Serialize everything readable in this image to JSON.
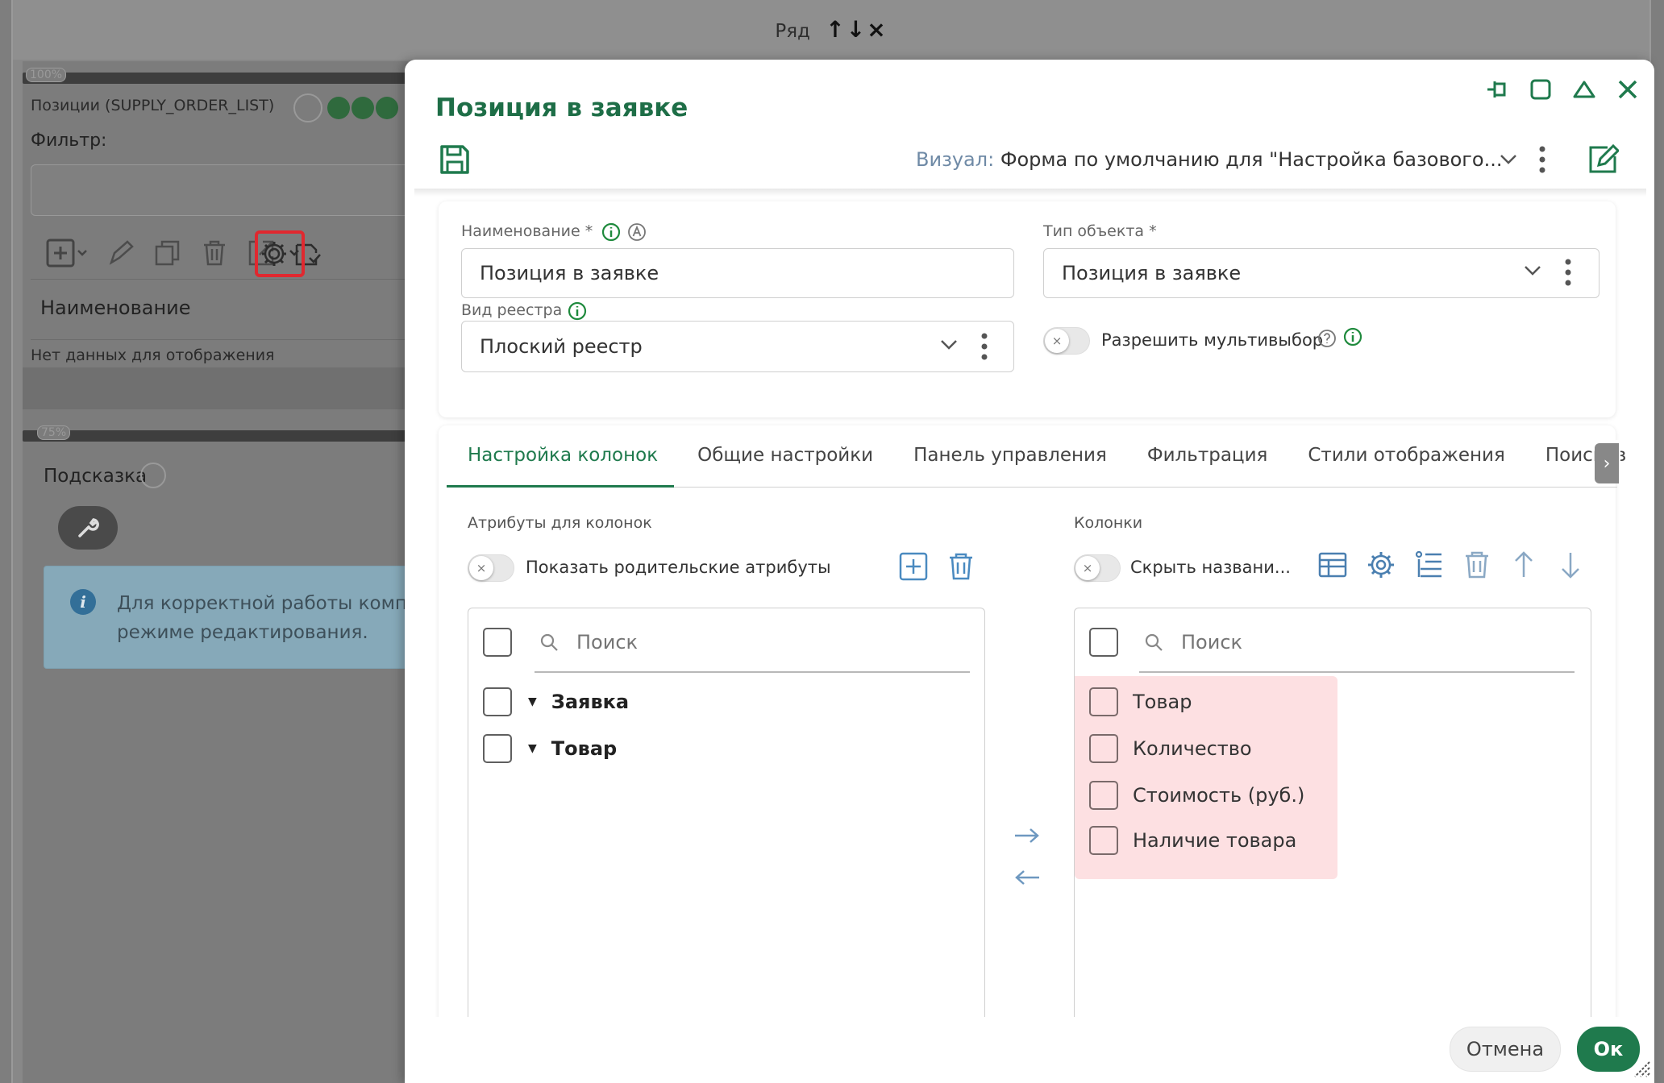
{
  "background": {
    "row_bar_title": "Ряд",
    "row_bar_arrows": "↑↓×",
    "progress_top": "100%",
    "progress_bottom": "75%",
    "list_title": "Позиции (SUPPLY_ORDER_LIST)",
    "filter_label": "Фильтр:",
    "column_header": "Наименование",
    "no_data": "Нет данных для отображения",
    "hint_title": "Подсказка",
    "info_text_line1": "Для корректной работы компо",
    "info_text_line2": "режиме редактирования."
  },
  "modal": {
    "title": "Позиция в заявке",
    "visual_label": "Визуал:",
    "visual_value": "Форма по умолчанию для \"Настройка базового...",
    "fields": {
      "name_label": "Наименование *",
      "name_value": "Позиция в заявке",
      "object_type_label": "Тип объекта *",
      "object_type_value": "Позиция в заявке",
      "registry_label": "Вид реестра",
      "registry_value": "Плоский реестр",
      "multiselect_label": "Разрешить мультивыбор"
    },
    "tabs": [
      "Настройка колонок",
      "Общие настройки",
      "Панель управления",
      "Фильтрация",
      "Стили отображения",
      "Поисков"
    ],
    "active_tab": "Настройка колонок",
    "left_panel": {
      "title": "Атрибуты для колонок",
      "toggle_label": "Показать родительские атрибуты",
      "search_placeholder": "Поиск",
      "items": [
        "Заявка",
        "Товар"
      ]
    },
    "right_panel": {
      "title": "Колонки",
      "toggle_label": "Скрыть названи...",
      "search_placeholder": "Поиск",
      "items": [
        "Товар",
        "Количество",
        "Стоимость (руб.)",
        "Наличие товара"
      ]
    },
    "buttons": {
      "cancel": "Отмена",
      "ok": "Ок"
    }
  },
  "colors": {
    "accent_green": "#1f7a4d",
    "highlight_red": "#e0282f",
    "selected_items_bg": "#fde0e2",
    "info_box_bg": "#86a9b9"
  },
  "icons": [
    "add-icon",
    "edit-icon",
    "copy-icon",
    "delete-icon",
    "export-icon",
    "import-icon",
    "gear-icon",
    "save-icon",
    "kebab-icon",
    "chevron-down-icon",
    "close-icon",
    "maximize-icon",
    "collapse-icon",
    "pin-icon",
    "info-icon",
    "search-icon",
    "arrow-right-icon",
    "arrow-left-icon",
    "arrow-up-icon",
    "arrow-down-icon",
    "table-icon",
    "list-settings-icon",
    "wrench-icon"
  ]
}
